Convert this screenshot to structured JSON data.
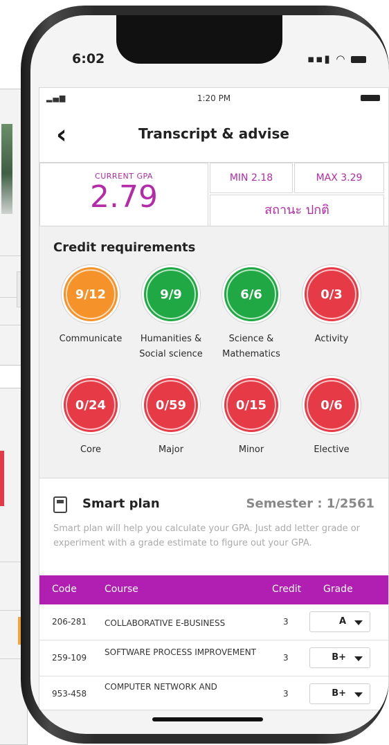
{
  "device": {
    "outer_time": "6:02"
  },
  "app": {
    "status_time": "1:20 PM",
    "title": "Transcript & advise"
  },
  "gpa": {
    "label": "CURRENT GPA",
    "value": "2.79",
    "min": "MIN 2.18",
    "max": "MAX 3.29",
    "status": "สถานะ ปกติ"
  },
  "credits": {
    "title": "Credit requirements",
    "items": [
      {
        "value": "9/12",
        "label1": "Communicate",
        "label2": "",
        "color": "#f5922a"
      },
      {
        "value": "9/9",
        "label1": "Humanities &",
        "label2": "Social science",
        "color": "#1fa843"
      },
      {
        "value": "6/6",
        "label1": "Science &",
        "label2": "Mathematics",
        "color": "#1fa843"
      },
      {
        "value": "0/3",
        "label1": "Activity",
        "label2": "",
        "color": "#e63a46"
      },
      {
        "value": "0/24",
        "label1": "Core",
        "label2": "",
        "color": "#e63a46"
      },
      {
        "value": "0/59",
        "label1": "Major",
        "label2": "",
        "color": "#e63a46"
      },
      {
        "value": "0/15",
        "label1": "Minor",
        "label2": "",
        "color": "#e63a46"
      },
      {
        "value": "0/6",
        "label1": "Elective",
        "label2": "",
        "color": "#e63a46"
      }
    ]
  },
  "smart_plan": {
    "title": "Smart plan",
    "semester": "Semester : 1/2561",
    "description": "Smart plan will help you calculate your GPA. Just add letter grade or experiment with a grade estimate to figure out your GPA.",
    "columns": {
      "code": "Code",
      "course": "Course",
      "credit": "Credit",
      "grade": "Grade"
    },
    "rows": [
      {
        "code": "206-281",
        "course": "COLLABORATIVE E-BUSINESS",
        "credit": "3",
        "grade": "A"
      },
      {
        "code": "259-109",
        "course": "SOFTWARE PROCESS IMPROVEMENT",
        "credit": "3",
        "grade": "B+"
      },
      {
        "code": "953-458",
        "course": "COMPUTER NETWORK AND",
        "credit": "3",
        "grade": "B+"
      }
    ]
  },
  "colors": {
    "accent": "#b11eb2",
    "gpa_text": "#b52aa8",
    "complete": "#1fa843",
    "partial": "#f5922a",
    "missing": "#e63a46"
  }
}
